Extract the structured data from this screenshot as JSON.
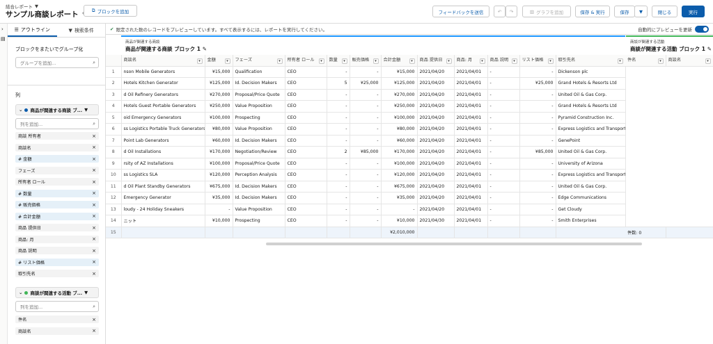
{
  "header": {
    "breadcrumb": "結合レポート",
    "title": "サンプル商談レポート",
    "add_block": "ブロックを追加",
    "feedback": "フィードバックを送信",
    "add_chart": "グラフを追加",
    "save_run": "保存 & 実行",
    "save": "保存",
    "close": "閉じる",
    "run": "実行"
  },
  "left": {
    "tab_outline": "アウトライン",
    "tab_filters": "検索条件",
    "group_title": "ブロックをまたいでグループ化",
    "group_placeholder": "グループを追加...",
    "columns_title": "列",
    "block1_name": "商品が関連する商談 ブ...",
    "block1_color": "#0b5cab",
    "col_placeholder": "列を追加...",
    "block1_columns": [
      {
        "label": "商談 所有者",
        "num": false
      },
      {
        "label": "商談名",
        "num": false
      },
      {
        "label": "# 金額",
        "num": true
      },
      {
        "label": "フェーズ",
        "num": false
      },
      {
        "label": "所有者 ロール",
        "num": false
      },
      {
        "label": "# 数量",
        "num": true
      },
      {
        "label": "# 販売価格",
        "num": true
      },
      {
        "label": "# 合計金額",
        "num": true
      },
      {
        "label": "商品 提供日",
        "num": false
      },
      {
        "label": "商品: 月",
        "num": false
      },
      {
        "label": "商品 説明",
        "num": false
      },
      {
        "label": "# リスト価格",
        "num": true
      },
      {
        "label": "取引先名",
        "num": false
      }
    ],
    "block2_name": "商談が関連する活動 ブ...",
    "block2_color": "#41b658",
    "block2_columns": [
      {
        "label": "件名"
      },
      {
        "label": "商談名"
      }
    ]
  },
  "main": {
    "info_text": "限定された数のレコードをプレビューしています。すべて表示するには、レポートを実行してください。",
    "auto_preview": "自動的にプレビューを更新",
    "block1_sub": "商品が関連する商談",
    "block1_title": "商品が関連する商談 ブロック 1",
    "block2_sub": "商談が関連する活動",
    "block2_title": "商談が関連する活動 ブロック 1",
    "columns": [
      "商談名",
      "金額",
      "フェーズ",
      "所有者 ロール",
      "数量",
      "販売価格",
      "合計金額",
      "商品 提供日",
      "商品: 月",
      "商品 説明",
      "リスト価格",
      "取引先名"
    ],
    "block2_columns": [
      "件名",
      "商談名"
    ],
    "rows": [
      [
        "1",
        "nson Mobile Generators",
        "¥15,000",
        "Qualification",
        "CEO",
        "-",
        "-",
        "¥15,000",
        "2021/04/20",
        "2021/04/01",
        "-",
        "-",
        "Dickenson plc"
      ],
      [
        "2",
        "Hotels Kitchen Generator",
        "¥125,000",
        "Id. Decision Makers",
        "CEO",
        "5",
        "¥25,000",
        "¥125,000",
        "2021/04/20",
        "2021/04/01",
        "-",
        "¥25,000",
        "Grand Hotels & Resorts Ltd"
      ],
      [
        "3",
        "d Oil Refinery Generators",
        "¥270,000",
        "Proposal/Price Quote",
        "CEO",
        "-",
        "-",
        "¥270,000",
        "2021/04/20",
        "2021/04/01",
        "-",
        "-",
        "United Oil & Gas Corp."
      ],
      [
        "4",
        "Hotels Guest Portable Generators",
        "¥250,000",
        "Value Proposition",
        "CEO",
        "-",
        "-",
        "¥250,000",
        "2021/04/20",
        "2021/04/01",
        "-",
        "-",
        "Grand Hotels & Resorts Ltd"
      ],
      [
        "5",
        "oid Emergency Generators",
        "¥100,000",
        "Prospecting",
        "CEO",
        "-",
        "-",
        "¥100,000",
        "2021/04/20",
        "2021/04/01",
        "-",
        "-",
        "Pyramid Construction Inc."
      ],
      [
        "6",
        "ss Logistics Portable Truck Generators",
        "¥80,000",
        "Value Proposition",
        "CEO",
        "-",
        "-",
        "¥80,000",
        "2021/04/20",
        "2021/04/01",
        "-",
        "-",
        "Express Logistics and Transport"
      ],
      [
        "7",
        "Point Lab Generators",
        "¥60,000",
        "Id. Decision Makers",
        "CEO",
        "-",
        "-",
        "¥60,000",
        "2021/04/20",
        "2021/04/01",
        "-",
        "-",
        "GenePoint"
      ],
      [
        "8",
        "d Oil Installations",
        "¥170,000",
        "Negotiation/Review",
        "CEO",
        "2",
        "¥85,000",
        "¥170,000",
        "2021/04/20",
        "2021/04/01",
        "-",
        "¥85,000",
        "United Oil & Gas Corp."
      ],
      [
        "9",
        "rsity of AZ Installations",
        "¥100,000",
        "Proposal/Price Quote",
        "CEO",
        "-",
        "-",
        "¥100,000",
        "2021/04/20",
        "2021/04/01",
        "-",
        "-",
        "University of Arizona"
      ],
      [
        "10",
        "ss Logistics SLA",
        "¥120,000",
        "Perception Analysis",
        "CEO",
        "-",
        "-",
        "¥120,000",
        "2021/04/20",
        "2021/04/01",
        "-",
        "-",
        "Express Logistics and Transport"
      ],
      [
        "11",
        "d Oil Plant Standby Generators",
        "¥675,000",
        "Id. Decision Makers",
        "CEO",
        "-",
        "-",
        "¥675,000",
        "2021/04/20",
        "2021/04/01",
        "-",
        "-",
        "United Oil & Gas Corp."
      ],
      [
        "12",
        "Emergency Generator",
        "¥35,000",
        "Id. Decision Makers",
        "CEO",
        "-",
        "-",
        "¥35,000",
        "2021/04/20",
        "2021/04/01",
        "-",
        "-",
        "Edge Communications"
      ],
      [
        "13",
        "loudy - 24 Holiday Sneakers",
        "-",
        "Value Proposition",
        "CEO",
        "-",
        "-",
        "-",
        "2021/04/20",
        "2021/04/01",
        "-",
        "-",
        "Get Cloudy"
      ],
      [
        "14",
        "ニット",
        "¥10,000",
        "Prospecting",
        "CEO",
        "-",
        "-",
        "¥10,000",
        "2021/04/30",
        "2021/04/01",
        "-",
        "-",
        "Smith Enterprises"
      ]
    ],
    "total_row_num": "15",
    "total_amount": "¥2,010,000",
    "block2_count": "件数: 0"
  }
}
